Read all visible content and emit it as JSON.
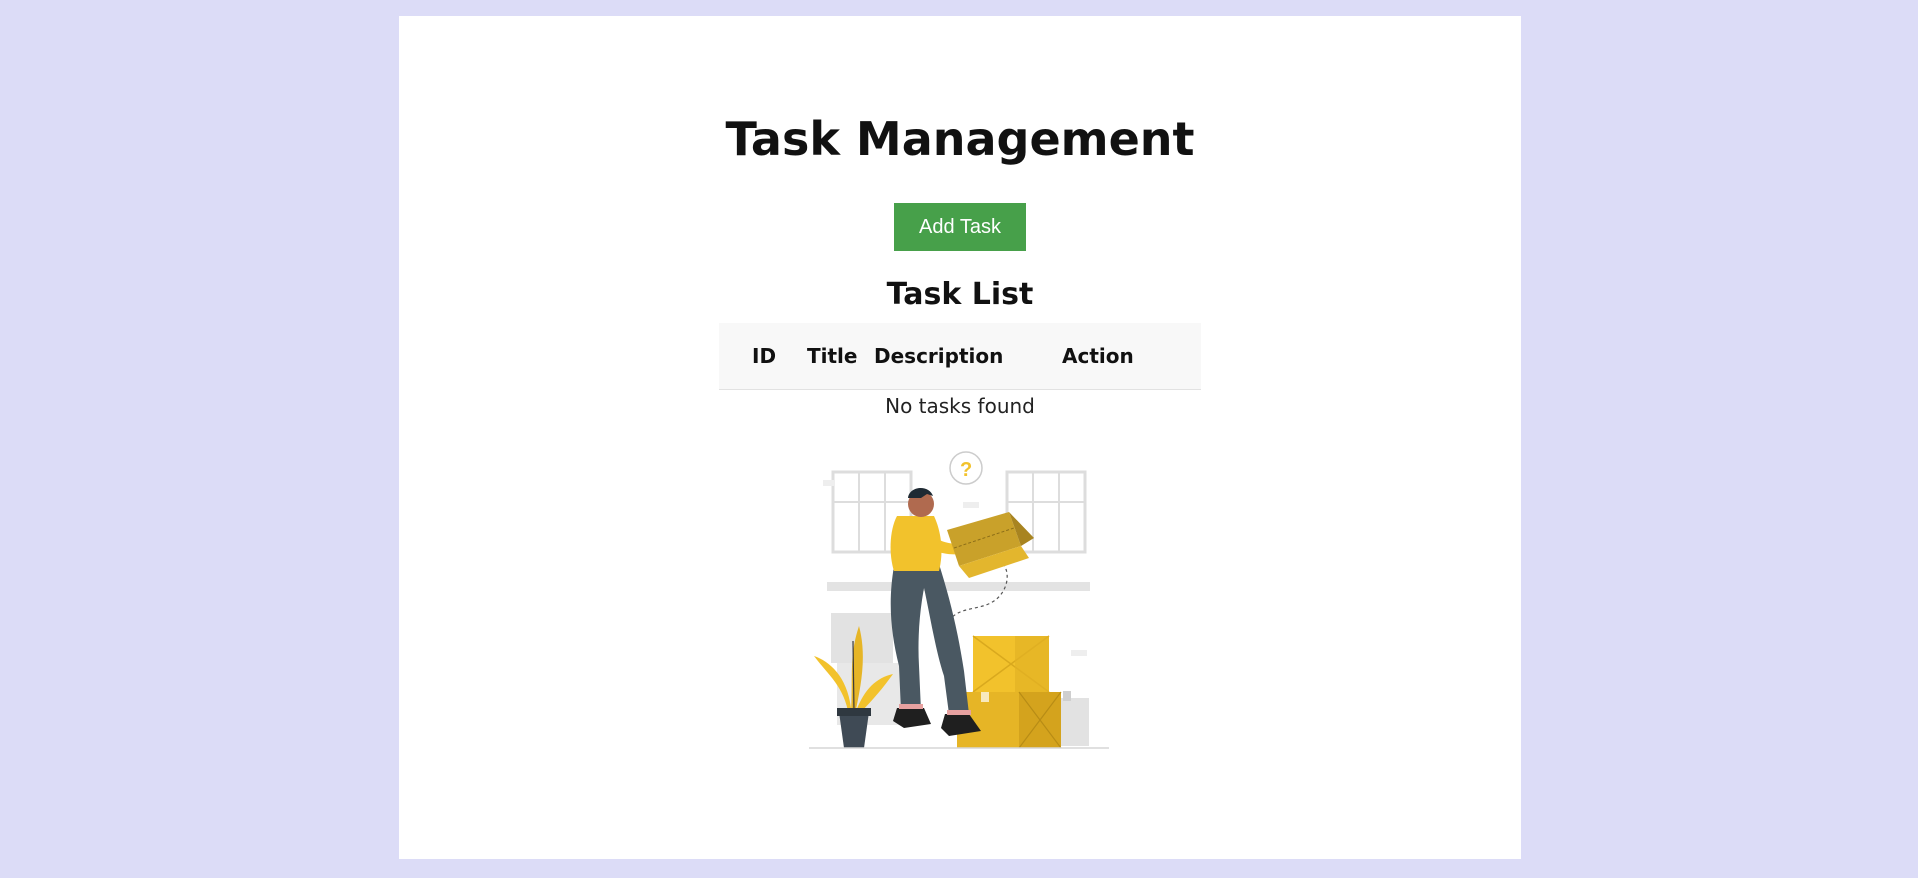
{
  "header": {
    "title": "Task Management"
  },
  "actions": {
    "add_task_label": "Add Task"
  },
  "task_list": {
    "title": "Task List",
    "columns": [
      "ID",
      "Title",
      "Description",
      "Action"
    ],
    "rows": [],
    "empty_message": "No tasks found"
  },
  "illustration": {
    "icon": "person-carrying-box-illustration"
  },
  "colors": {
    "background": "#dcdcf7",
    "card": "#ffffff",
    "button": "#47a04a",
    "accent_yellow": "#f2c22c"
  }
}
